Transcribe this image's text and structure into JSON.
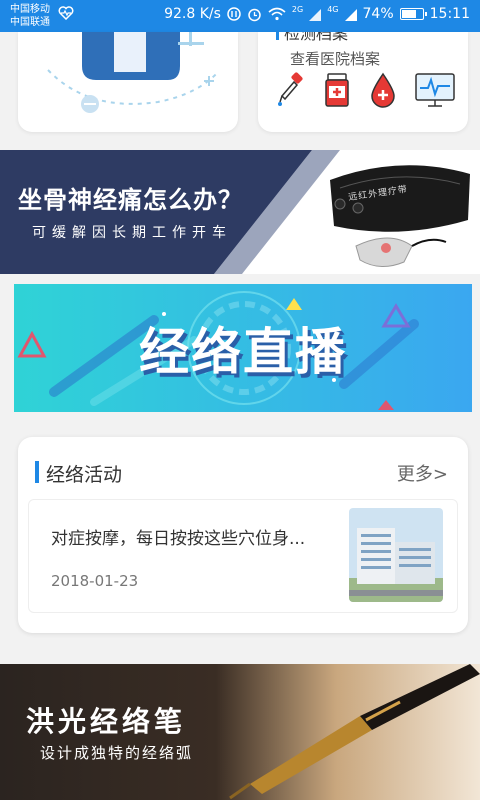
{
  "status_bar": {
    "carrier1": "中国移动",
    "carrier2": "中国联通",
    "speed": "92.8 K/s",
    "signal1": "2G",
    "signal2": "4G",
    "battery_pct": "74%",
    "battery_level": 0.74,
    "time": "15:11"
  },
  "top_right_card": {
    "title": "检测档案",
    "subtitle": "查看医院档案"
  },
  "banner_sciatica": {
    "headline": "坐骨神经痛怎么办？",
    "subline": "可缓解因长期工作开车",
    "product_label": "远红外理疗带"
  },
  "banner_live": {
    "text": "经络直播"
  },
  "activity": {
    "title": "经络活动",
    "more": "更多>",
    "items": [
      {
        "title": "对症按摩，每日按按这些穴位身...",
        "date": "2018-01-23"
      }
    ]
  },
  "banner_pen": {
    "title": "洪光经络笔",
    "subtitle": "设计成独特的经络弧"
  },
  "colors": {
    "primary": "#1e88e5",
    "navy": "#2e3b63",
    "live_start": "#2fd3d6",
    "live_end": "#3aa7f0"
  }
}
